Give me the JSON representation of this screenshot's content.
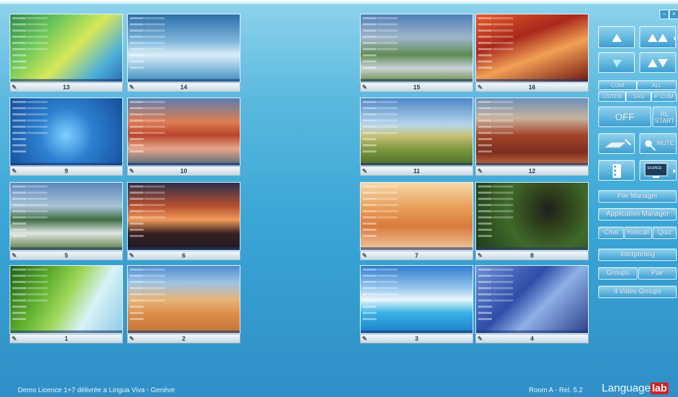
{
  "thumbnails": [
    {
      "label": "13",
      "bg": "linear-gradient(135deg,#2f8a4a 0%,#6ec85b 30%,#d8e85a 55%,#4fb0d8 80%,#2a6fb7 100%)"
    },
    {
      "label": "14",
      "bg": "linear-gradient(180deg,#2b6ea8 0%,#7fb6dc 40%,#d9eef7 60%,#3e8ec2 100%)"
    },
    {
      "label": "15",
      "bg": "linear-gradient(180deg,#4f7fb8 0%,#9fb6c9 35%,#5f8a53 60%,#c8d3d8 80%,#6f8f4a 100%)"
    },
    {
      "label": "16",
      "bg": "linear-gradient(160deg,#e65c2b 0%,#a8281c 35%,#f2a055 60%,#70160f 100%)"
    },
    {
      "label": "9",
      "bg": "radial-gradient(circle at 50% 55%,#7fd0ff 0%,#2c7fd0 40%,#164e9a 100%)"
    },
    {
      "label": "10",
      "bg": "linear-gradient(180deg,#5a7fb0 0%,#e07c52 35%,#b8452c 55%,#e9a58a 75%,#51697f 100%)"
    },
    {
      "label": "11",
      "bg": "linear-gradient(180deg,#4f87c8 0%,#b7d6ea 40%,#c9c27a 55%,#7f9a40 75%,#4e6e2a 100%)"
    },
    {
      "label": "12",
      "bg": "linear-gradient(180deg,#6d8fb8 0%,#c9b39c 30%,#a2432a 55%,#7d2e1d 80%,#c06b3f 100%)"
    },
    {
      "label": "5",
      "bg": "linear-gradient(180deg,#5c86bc 0%,#a9c3d6 35%,#3f6d44 55%,#dfe6e6 75%,#5b7b3a 100%)"
    },
    {
      "label": "6",
      "bg": "linear-gradient(180deg,#2c2f4a 0%,#b8502f 35%,#f09b5a 55%,#3a2022 75%,#1b1b22 100%)"
    },
    {
      "label": "7",
      "bg": "linear-gradient(180deg,#f6d8a5 0%,#e79a55 40%,#d97a3e 65%,#f0c89a 100%)"
    },
    {
      "label": "8",
      "bg": "radial-gradient(circle at 65% 40%,#1f1f1f 0%,#2e3d1a 20%,#3f6a2a 50%,#1f3a18 100%)"
    },
    {
      "label": "1",
      "bg": "linear-gradient(120deg,#1e5e1a 0%,#5fae2e 30%,#9fd85b 50%,#d9f2f8 70%,#8fcbe6 100%)"
    },
    {
      "label": "2",
      "bg": "linear-gradient(180deg,#4d8bd0 0%,#9dc3e6 25%,#e7b477 50%,#d98a45 75%,#c4753a 100%)"
    },
    {
      "label": "3",
      "bg": "linear-gradient(180deg,#2f7dd0 0%,#9fcbee 35%,#e8f5fb 50%,#39b2e4 70%,#1d7fc7 100%)"
    },
    {
      "label": "4",
      "bg": "linear-gradient(135deg,#6f8fd8 0%,#2d4ea6 40%,#8fb0e8 60%,#2c3f8a 100%)"
    }
  ],
  "sidebar": {
    "com": "COM",
    "all": "ALL",
    "listen": "LISTEN",
    "sas": "SAS",
    "pcom": "P. COM",
    "off": "OFF",
    "restart_line1": "RE",
    "restart_line2": "START",
    "mute": "MUTE",
    "silence": "SILENCE",
    "file_manager": "File Manager",
    "application_manager": "Application Manager",
    "chat": "Chat",
    "rollcall": "Rollcall",
    "quiz": "Quiz",
    "interpreting": "Interpreting",
    "groups": "Groups",
    "pair": "Pair",
    "video_groups": "4 Video Groups"
  },
  "footer": {
    "licence": "Demo Licence 1+7 délivrée a Lingua Viva - Genève",
    "room": "Room A - Rel. 5.2",
    "logo_text": "Language",
    "logo_badge": "lab"
  },
  "colors": {
    "accent": "#3aa6d6",
    "button": "#4aa9d9"
  }
}
